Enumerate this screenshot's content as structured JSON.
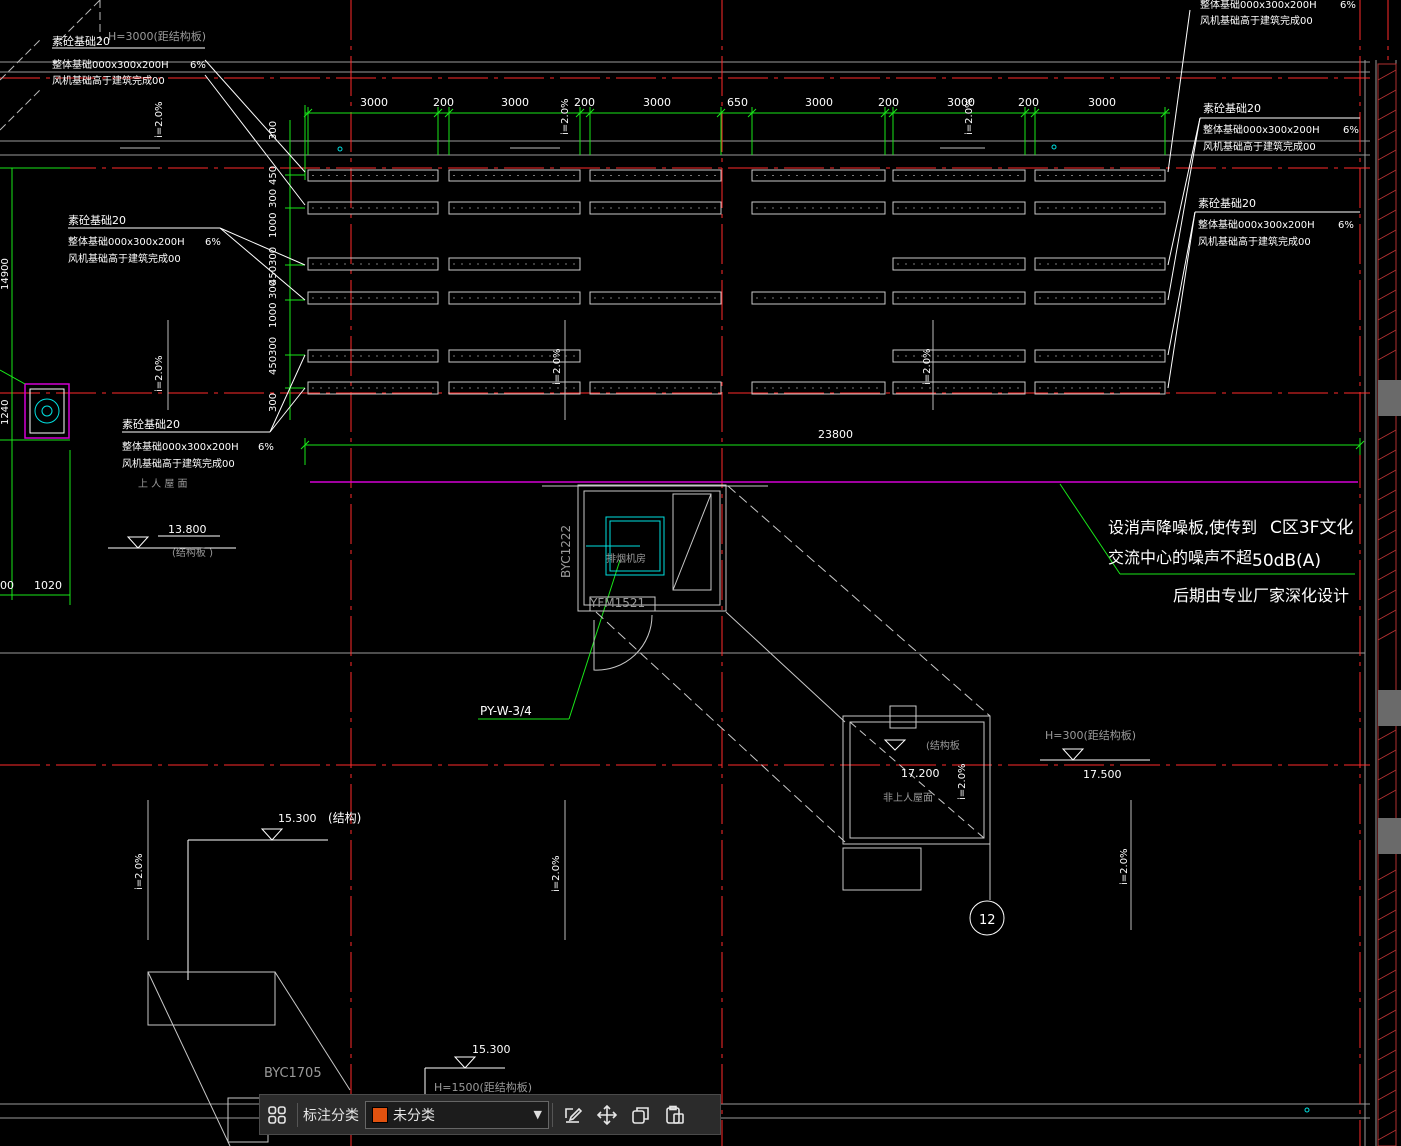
{
  "drawing": {
    "colors": {
      "red": "#ff2a2a",
      "green": "#19e619",
      "white": "#ffffff",
      "magenta": "#d400d4",
      "cyan": "#00e0e0",
      "gray": "#9a9a9a"
    },
    "dims_top": [
      "3000",
      "200",
      "3000",
      "200",
      "3000",
      "650",
      "3000",
      "200",
      "3000",
      "200",
      "3000"
    ],
    "dims_vertical": [
      "300",
      "450",
      "300",
      "1000",
      "300",
      "450",
      "300",
      "1000",
      "300",
      "450",
      "300"
    ],
    "overall_dim": "23800",
    "slope_label": "i=2.0%",
    "top_left_note": "H=3000(距结构板)",
    "foundation_note_a": "素砼基础20",
    "foundation_note_b": "整体基础000x300x200H",
    "foundation_note_b2": "整体基础000x300x200H",
    "foundation_note_c": "风机基础高于建筑完成00",
    "foundation_note_frac": "6%",
    "foundation_note_top_right_b": "整体基础000x300x200H",
    "foundation_note_top_right_c": "风机基础高于建筑完成00",
    "roof_label": "上 人 屋 面",
    "elev_1": "13.800",
    "elev_1_note": "(结构板      )",
    "dim_small_a": "00",
    "dim_small_b": "1020",
    "dim_left_1": "14900",
    "dim_left_2": "1240",
    "byc1222": "BYC1222",
    "yfm1521": "YFM1521",
    "room_label": "排烟机房",
    "py_label": "PY-W-3/4",
    "noise_note_line1": "设消声降噪板,使传到",
    "noise_note_line2": "交流中心的噪声不超",
    "noise_note_right1": "C区3F文化",
    "noise_note_right2": "50dB(A)",
    "noise_note_line3": "后期由专业厂家深化设计",
    "struct_label": "(结构板",
    "elev_2": "17.200",
    "nonroof_label": "非上人屋面",
    "h300_note": "H=300(距结构板)",
    "elev_3": "17.500",
    "axis_12": "12",
    "elev_4": "15.300",
    "elev_4_note": "(结构)",
    "byc1705": "BYC1705",
    "elev_5": "15.300",
    "h1500_note": "H=1500(距结构板)",
    "top_right_dims": "风机基础高于建筑完成00"
  },
  "toolbar": {
    "label": "标注分类",
    "select_value": "未分类",
    "select_color": "#e2520f",
    "icons": [
      "grid-icon",
      "edit-icon",
      "move-icon",
      "copy-icon",
      "paste-icon"
    ]
  }
}
